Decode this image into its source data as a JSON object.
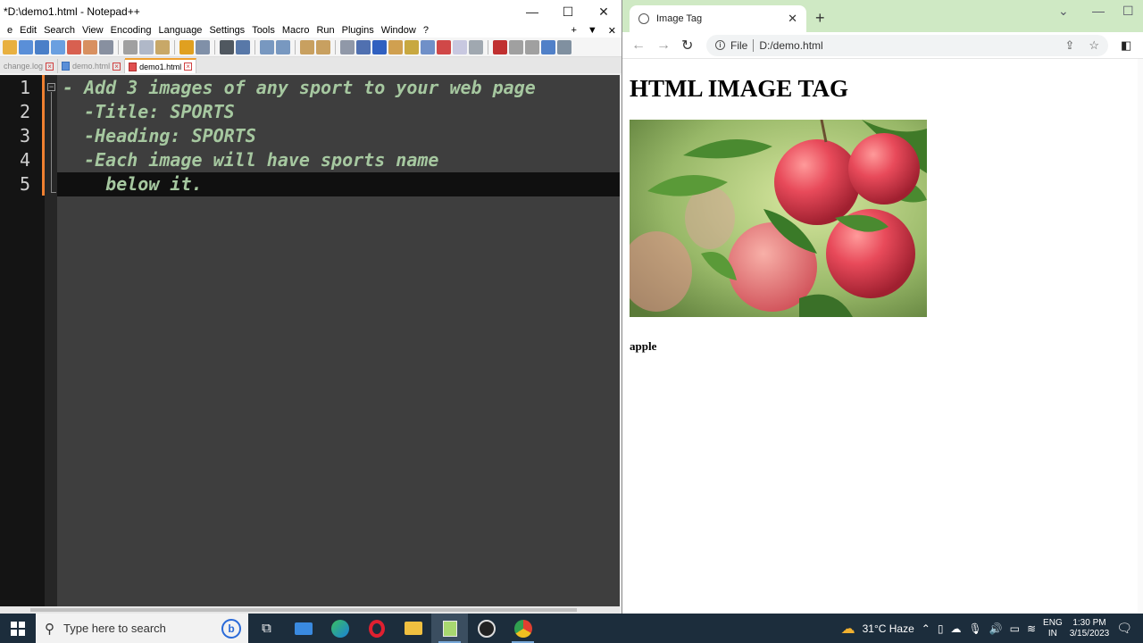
{
  "notepad": {
    "title": "*D:\\demo1.html - Notepad++",
    "window_controls": [
      "—",
      "☐",
      "✕"
    ],
    "menu": [
      "e",
      "Edit",
      "Search",
      "View",
      "Encoding",
      "Language",
      "Settings",
      "Tools",
      "Macro",
      "Run",
      "Plugins",
      "Window",
      "?"
    ],
    "menu_right": [
      "+",
      "▼",
      "✕"
    ],
    "tabs": [
      {
        "label": "change.log",
        "active": false
      },
      {
        "label": "demo.html",
        "active": false
      },
      {
        "label": "demo1.html",
        "active": true
      }
    ],
    "line_numbers": [
      "1",
      "2",
      "3",
      "4",
      "5"
    ],
    "lines": [
      "- Add 3 images of any sport to your web page",
      "  -Title: SPORTS",
      "  -Heading: SPORTS",
      "  -Each image will have sports name",
      "    below it."
    ]
  },
  "chrome": {
    "tab_title": "Image Tag",
    "new_tab": "+",
    "url_scheme_label": "File",
    "url": "D:/demo.html",
    "page": {
      "heading": "HTML IMAGE TAG",
      "caption": "apple"
    }
  },
  "taskbar": {
    "search_placeholder": "Type here to search",
    "weather": "31°C  Haze",
    "lang_top": "ENG",
    "lang_bottom": "IN",
    "time": "1:30 PM",
    "date": "3/15/2023"
  },
  "colors": {
    "editor_bg": "#3e3e3e",
    "code_text": "#a6c8a0",
    "chrome_tabbar": "#cfe9c4",
    "taskbar": "#1c2d3c"
  }
}
